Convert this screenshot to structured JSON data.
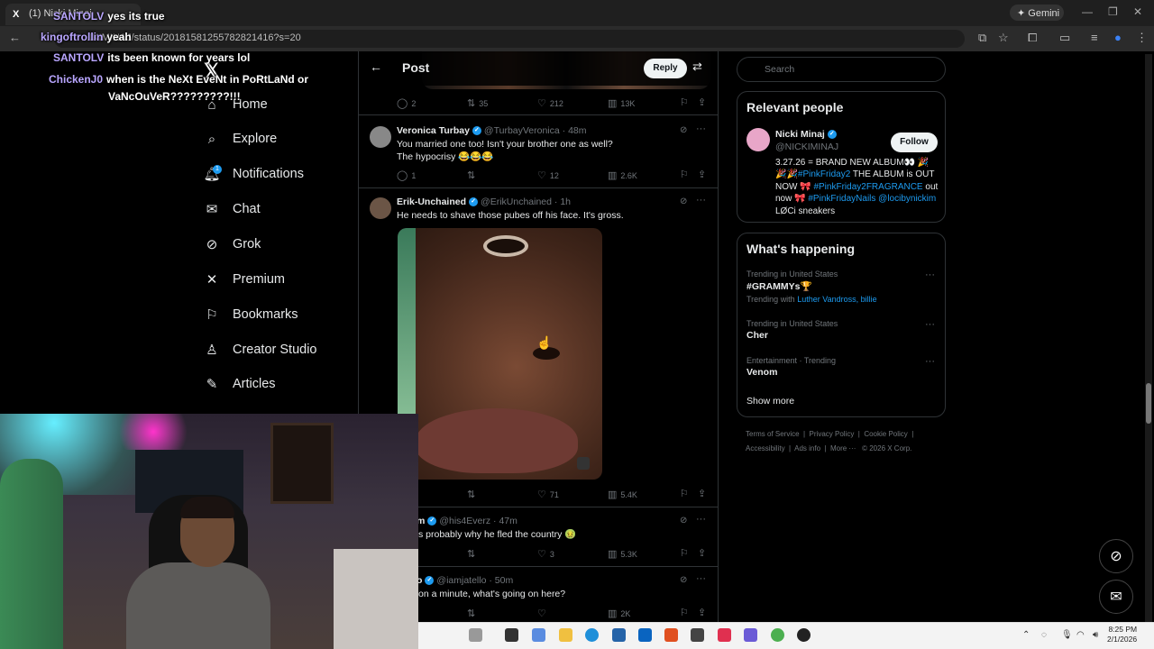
{
  "browser": {
    "tab_title": "(1) Nicki Minaj",
    "favicon": "X",
    "url": "...IKIMINAJ/status/20181581255782821416?s=20",
    "gemini_label": "Gemini"
  },
  "chat": [
    {
      "user": "SANTOLV",
      "message": "yes its true"
    },
    {
      "user": "kingoftrollin",
      "message": "yeah"
    },
    {
      "user": "SANTOLV",
      "message": "its been known for years lol"
    },
    {
      "user": "ChickenJ0",
      "message": "when is the NeXt EveNt in PoRtLaNd or"
    },
    {
      "user": "",
      "message": "VaNcOuVeR?????????!!!"
    }
  ],
  "sidebar": {
    "items": [
      {
        "label": "Home",
        "icon": "home-icon"
      },
      {
        "label": "Explore",
        "icon": "search-icon"
      },
      {
        "label": "Notifications",
        "icon": "bell-icon",
        "badge": "1"
      },
      {
        "label": "Chat",
        "icon": "mail-icon"
      },
      {
        "label": "Grok",
        "icon": "grok-icon"
      },
      {
        "label": "Premium",
        "icon": "x-icon"
      },
      {
        "label": "Bookmarks",
        "icon": "bookmark-icon"
      },
      {
        "label": "Creator Studio",
        "icon": "creator-icon"
      },
      {
        "label": "Articles",
        "icon": "article-icon"
      }
    ]
  },
  "post_header": {
    "title": "Post",
    "reply_label": "Reply"
  },
  "top_actions": {
    "replies": "2",
    "reposts": "35",
    "likes": "212",
    "views": "13K"
  },
  "replies": [
    {
      "name": "Veronica Turbay",
      "handle": "@TurbayVeronica",
      "time": "· 48m",
      "lines": [
        "You married one too! Isn't your brother one as well?",
        "The hypocrisy 😂😂😂"
      ],
      "replies": "1",
      "reposts": "",
      "likes": "12",
      "views": "2.6K"
    },
    {
      "name": "Erik-Unchained",
      "handle": "@ErikUnchained",
      "time": "· 1h",
      "lines": [
        "He needs to shave those pubes off his face. It's gross."
      ],
      "replies": "",
      "reposts": "",
      "likes": "71",
      "views": "5.4K"
    },
    {
      "name": "m",
      "handle": "@his4Everz",
      "time": "· 47m",
      "lines": [
        "s probably why he fled the country 🤢"
      ],
      "replies": "",
      "reposts": "",
      "likes": "3",
      "views": "5.3K"
    },
    {
      "name": "o",
      "handle": "@iamjatello",
      "time": "· 50m",
      "lines": [
        "on a minute, what's going on here?"
      ],
      "replies": "",
      "reposts": "",
      "likes": "",
      "views": "2K"
    }
  ],
  "right": {
    "search_placeholder": "Search",
    "relevant_title": "Relevant people",
    "person": {
      "name": "Nicki Minaj",
      "handle": "@NICKIMINAJ",
      "follow_label": "Follow",
      "bio_parts": [
        {
          "t": "3.27.26 = BRAND NEW ALBUM👀 🎉",
          "c": ""
        },
        {
          "t": "🎉🎉",
          "c": ""
        },
        {
          "t": "#PinkFriday2",
          "c": "blue"
        },
        {
          "t": " THE ALBUM is OUT NOW 🎀 ",
          "c": ""
        },
        {
          "t": "#PinkFriday2FRAGRANCE",
          "c": "blue"
        },
        {
          "t": " out now 🎀 ",
          "c": ""
        },
        {
          "t": "#PinkFridayNails",
          "c": "blue"
        },
        {
          "t": " ",
          "c": ""
        },
        {
          "t": "@locibynickim",
          "c": "blue"
        },
        {
          "t": " LØCi sneakers",
          "c": ""
        }
      ]
    },
    "happening_title": "What's happening",
    "trends": [
      {
        "meta": "Trending in United States",
        "name": "#GRAMMYs🏆",
        "with_label": "Trending with",
        "with": "Luther Vandross, billie"
      },
      {
        "meta": "Trending in United States",
        "name": "Cher"
      },
      {
        "meta": "Entertainment · Trending",
        "name": "Venom"
      }
    ],
    "show_more": "Show more",
    "footer_line1": [
      "Terms of Service",
      "Privacy Policy",
      "Cookie Policy"
    ],
    "footer_line2": [
      "Accessibility",
      "Ads info",
      "More ···",
      "© 2026 X Corp."
    ]
  },
  "taskbar": {
    "time": "8:25 PM",
    "date": "2/1/2026"
  },
  "colors": {
    "accent": "#1d9bf0",
    "bg": "#000000",
    "border": "#2f3336",
    "muted": "#71767b"
  }
}
